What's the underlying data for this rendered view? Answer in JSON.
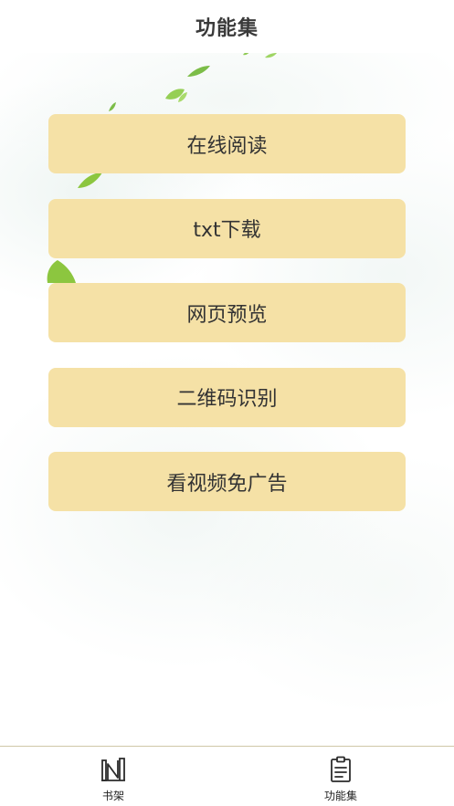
{
  "header": {
    "title": "功能集"
  },
  "menu": {
    "items": [
      {
        "label": "在线阅读"
      },
      {
        "label": "txt下载"
      },
      {
        "label": "网页预览"
      },
      {
        "label": "二维码识别"
      },
      {
        "label": "看视频免广告"
      }
    ]
  },
  "tabbar": {
    "tabs": [
      {
        "label": "书架",
        "icon": "bookshelf-icon"
      },
      {
        "label": "功能集",
        "icon": "clipboard-icon",
        "active": true
      }
    ]
  },
  "colors": {
    "button_bg": "#f5e1a6",
    "leaf_green": "#8cc63f",
    "divider": "#cfc7a8"
  }
}
